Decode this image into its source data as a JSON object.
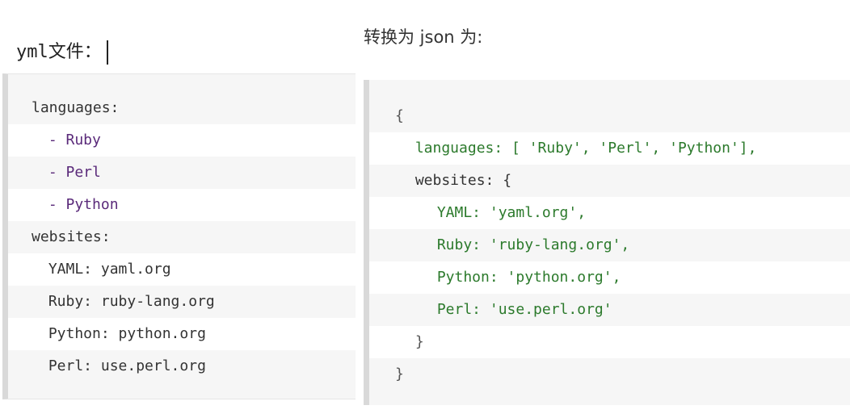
{
  "captions": {
    "yml_label": "yml文件：",
    "json_label": "转换为 json 为:"
  },
  "yml_block": {
    "lines": [
      "languages:",
      " - Ruby",
      " - Perl",
      " - Python",
      "websites:",
      " YAML: yaml.org",
      " Ruby: ruby-lang.org",
      " Python: python.org",
      " Perl: use.perl.org"
    ]
  },
  "json_block": {
    "lines": [
      "{",
      " languages: [ 'Ruby', 'Perl', 'Python'],",
      " websites: {",
      " YAML: 'yaml.org',",
      " Ruby: 'ruby-lang.org',",
      " Python: 'python.org',",
      " Perl: 'use.perl.org'",
      " }",
      "}"
    ]
  }
}
